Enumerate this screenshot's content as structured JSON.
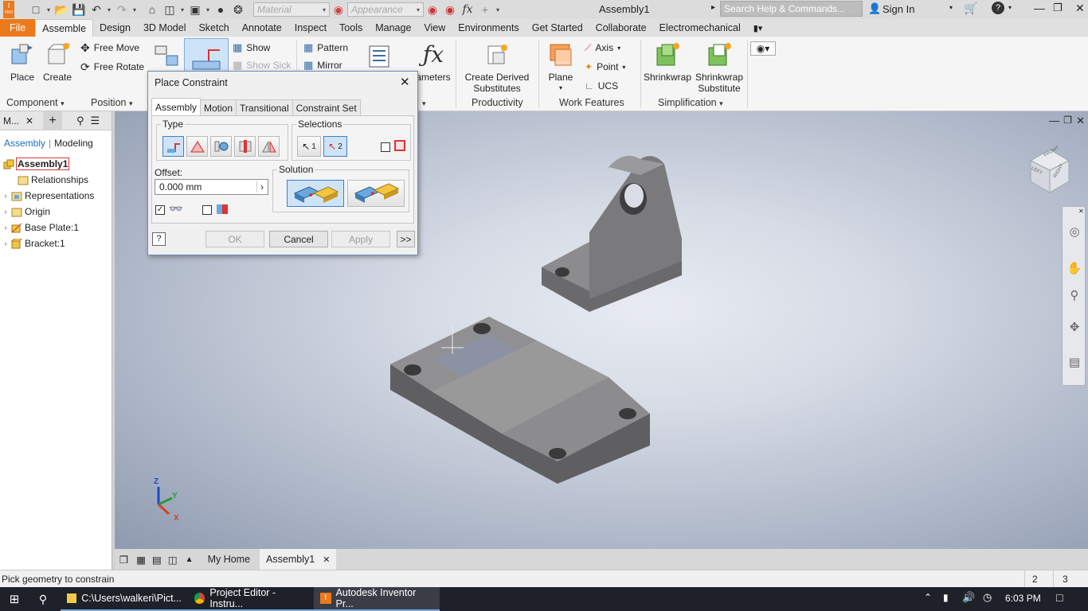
{
  "window": {
    "app_initial": "I",
    "app_sub": "PRO",
    "title": "Assembly1",
    "search_placeholder": "Search Help & Commands...",
    "sign_in": "Sign In",
    "material_placeholder": "Material",
    "appearance_placeholder": "Appearance",
    "fx_label": "fx"
  },
  "menu": {
    "tabs": [
      "File",
      "Assemble",
      "Design",
      "3D Model",
      "Sketch",
      "Annotate",
      "Inspect",
      "Tools",
      "Manage",
      "View",
      "Environments",
      "Get Started",
      "Collaborate",
      "Electromechanical"
    ],
    "active": "Assemble"
  },
  "ribbon": {
    "place": "Place",
    "create": "Create",
    "free_move": "Free Move",
    "free_rotate": "Free Rotate",
    "show": "Show",
    "show_sick": "Show Sick",
    "pattern": "Pattern",
    "mirror": "Mirror",
    "parameters": "ameters",
    "create_derived": "Create Derived",
    "substitutes": "Substitutes",
    "plane": "Plane",
    "axis": "Axis",
    "point": "Point",
    "ucs": "UCS",
    "shrinkwrap": "Shrinkwrap",
    "shrinkwrap_sub_1": "Shrinkwrap",
    "shrinkwrap_sub_2": "Substitute",
    "groups": {
      "component": "Component",
      "position": "Position",
      "productivity": "Productivity",
      "work_features": "Work Features",
      "simplification": "Simplification"
    }
  },
  "browser": {
    "header": "M...",
    "mode_assembly": "Assembly",
    "mode_modeling": "Modeling",
    "tree": [
      {
        "label": "Assembly1",
        "icon": "assembly-icon",
        "level": 0,
        "expand": ""
      },
      {
        "label": "Relationships",
        "icon": "folder-icon",
        "level": 1,
        "expand": ""
      },
      {
        "label": "Representations",
        "icon": "representations-icon",
        "level": 1,
        "expand": "›"
      },
      {
        "label": "Origin",
        "icon": "folder-icon",
        "level": 1,
        "expand": "›"
      },
      {
        "label": "Base Plate:1",
        "icon": "part-icon",
        "level": 1,
        "expand": "›"
      },
      {
        "label": "Bracket:1",
        "icon": "part-icon",
        "level": 1,
        "expand": "›"
      }
    ]
  },
  "dialog": {
    "title": "Place Constraint",
    "tabs": [
      "Assembly",
      "Motion",
      "Transitional",
      "Constraint Set"
    ],
    "active_tab": "Assembly",
    "type_label": "Type",
    "selections_label": "Selections",
    "sel1": "1",
    "sel2": "2",
    "offset_label": "Offset:",
    "offset_value": "0.000 mm",
    "solution_label": "Solution",
    "ok": "OK",
    "cancel": "Cancel",
    "apply": "Apply",
    "more": ">>",
    "help": "?",
    "show_preview_checked": true,
    "predict_offset_checked": false,
    "first_part_checked": false
  },
  "viewport": {
    "viewcube_top": "FRONT",
    "viewcube_left": "LEFT",
    "viewcube_right": "RIGHT",
    "axis_x": "X",
    "axis_y": "Y",
    "axis_z": "Z"
  },
  "doctabs": {
    "home": "My Home",
    "doc": "Assembly1",
    "close": "✕"
  },
  "status": {
    "text": "Pick geometry to constrain",
    "num1": "2",
    "num2": "3"
  },
  "taskbar": {
    "items": [
      {
        "label": "C:\\Users\\walkeri\\Pict...",
        "icon": "folder-icon"
      },
      {
        "label": "Project Editor - Instru...",
        "icon": "chrome-icon"
      },
      {
        "label": "Autodesk Inventor Pr...",
        "icon": "inventor-icon"
      }
    ],
    "time": "6:03 PM"
  },
  "colors": {
    "accent": "#ec7a1c",
    "selection": "#3d7fc6",
    "part_gray": "#8a8a8c"
  }
}
